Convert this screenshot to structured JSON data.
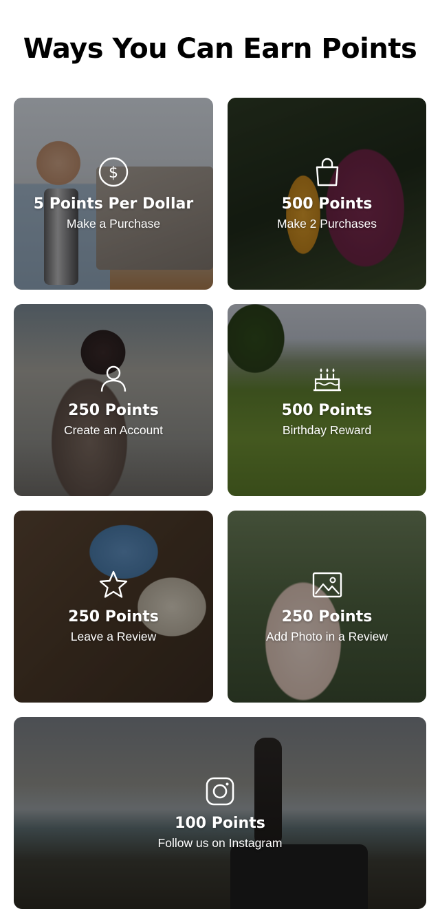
{
  "page": {
    "title": "Ways You Can Earn Points"
  },
  "cards": [
    {
      "points": "5 Points Per Dollar",
      "subtitle": "Make a Purchase",
      "icon": "dollar-circle-icon"
    },
    {
      "points": "500 Points",
      "subtitle": "Make 2 Purchases",
      "icon": "shopping-bag-icon"
    },
    {
      "points": "250 Points",
      "subtitle": "Create an Account",
      "icon": "user-icon"
    },
    {
      "points": "500 Points",
      "subtitle": "Birthday Reward",
      "icon": "birthday-cake-icon"
    },
    {
      "points": "250 Points",
      "subtitle": "Leave a Review",
      "icon": "star-icon"
    },
    {
      "points": "250 Points",
      "subtitle": "Add Photo in a Review",
      "icon": "photo-icon"
    },
    {
      "points": "100 Points",
      "subtitle": "Follow us on Instagram",
      "icon": "instagram-icon"
    }
  ],
  "colors": {
    "title": "#000000",
    "card_text": "#ffffff",
    "overlay": "rgba(0,0,0,0.38)"
  }
}
